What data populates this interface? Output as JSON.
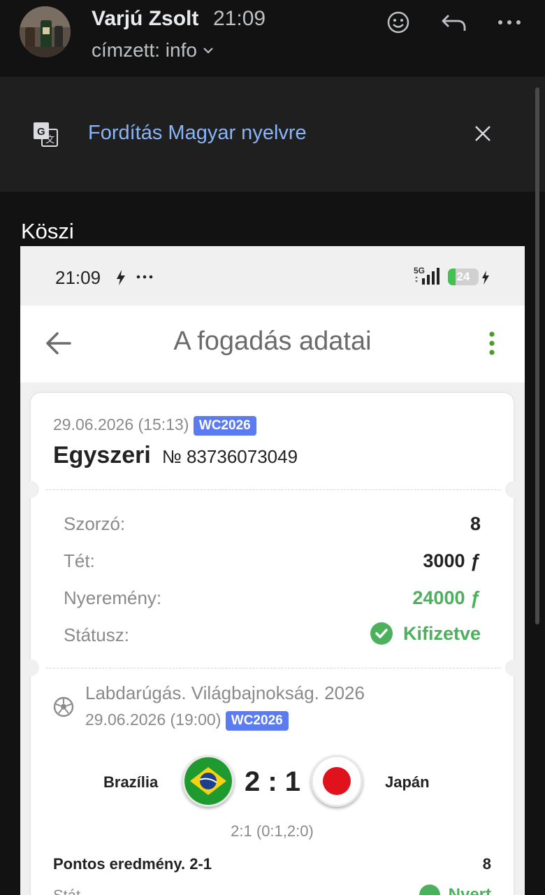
{
  "email": {
    "sender_name": "Varjú Zsolt",
    "time": "21:09",
    "recipient": "címzett: info",
    "icons": [
      "emoji-icon",
      "reply-icon",
      "more-icon"
    ]
  },
  "translate_bar": {
    "text": "Fordítás Magyar nyelvre",
    "accent": "#8ab4f8"
  },
  "body_text": "Köszi",
  "screenshot": {
    "status_bar": {
      "time": "21:09",
      "network": "5G",
      "battery": "24"
    },
    "app_title": "A fogadás adatai",
    "bet": {
      "datetime": "29.06.2026 (15:13)",
      "badge": "WC2026",
      "type": "Egyszeri",
      "number": "№ 83736073049"
    },
    "details": [
      {
        "label": "Szorzó:",
        "value": "8"
      },
      {
        "label": "Tét:",
        "value": "3000 ƒ"
      },
      {
        "label": "Nyeremény:",
        "value": "24000 ƒ"
      },
      {
        "label": "Státusz:",
        "value": "Kifizetve"
      }
    ],
    "event": {
      "title": "Labdarúgás. Világbajnokság. 2026",
      "datetime": "29.06.2026 (19:00)",
      "badge": "WC2026",
      "home_team": "Brazília",
      "away_team": "Japán",
      "score": "2 : 1",
      "score_detail": "2:1 (0:1,2:0)",
      "market": "Pontos eredmény. 2-1",
      "odds": "8",
      "status_label_partial": "Stát",
      "status_value_partial": "Nyert"
    },
    "colors": {
      "green": "#4cb05c",
      "badge": "#5b7cf0"
    }
  }
}
